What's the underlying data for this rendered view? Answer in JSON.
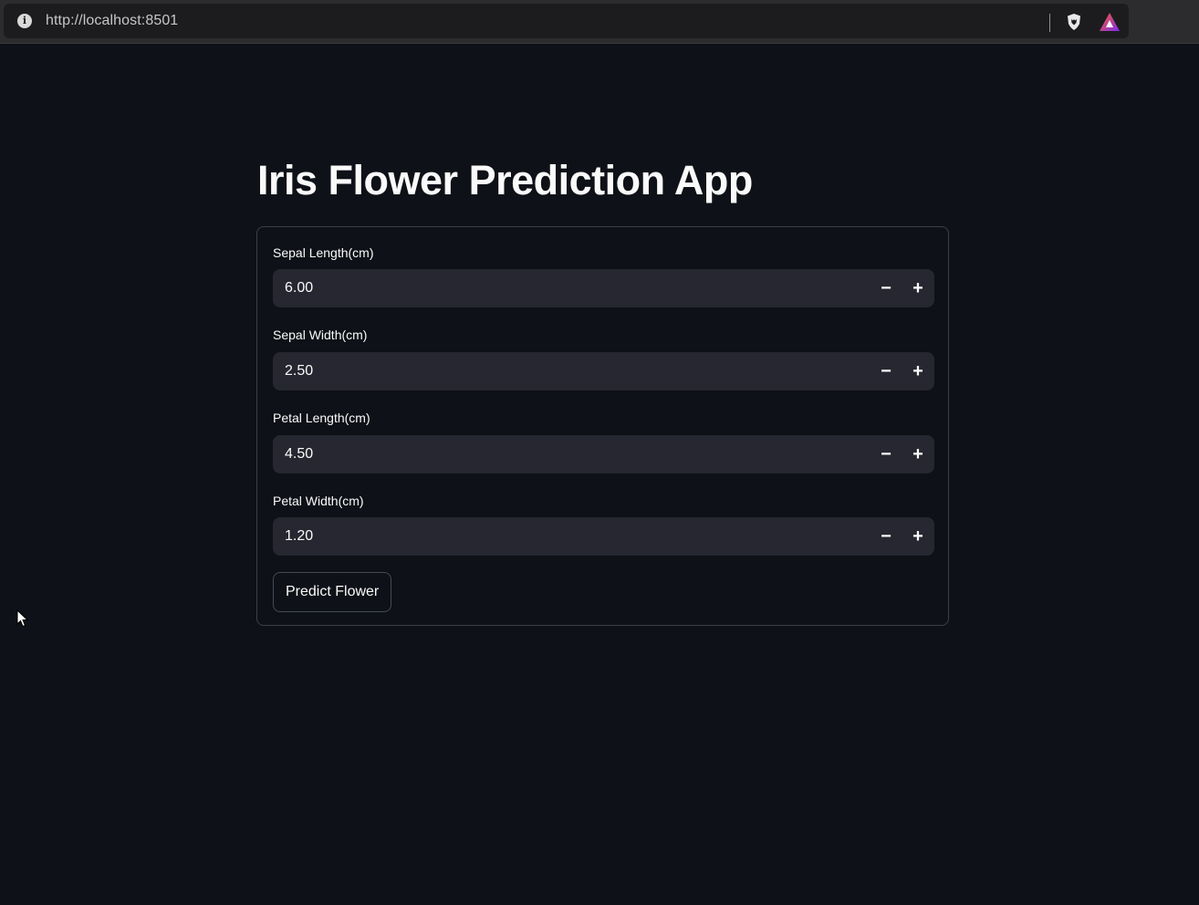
{
  "browser": {
    "url": "http://localhost:8501",
    "icons": [
      "info-icon",
      "brave-shield-icon",
      "brave-rewards-icon"
    ]
  },
  "app": {
    "title": "Iris Flower Prediction App"
  },
  "form": {
    "fields": [
      {
        "label": "Sepal Length(cm)",
        "value": "6.00"
      },
      {
        "label": "Sepal Width(cm)",
        "value": "2.50"
      },
      {
        "label": "Petal Length(cm)",
        "value": "4.50"
      },
      {
        "label": "Petal Width(cm)",
        "value": "1.20"
      }
    ],
    "stepper": {
      "minus": "−",
      "plus": "+"
    },
    "submit_label": "Predict Flower"
  },
  "colors": {
    "background": "#0e1117",
    "input_background": "#262730",
    "text": "#fafafa",
    "card_border": "#3d4049"
  }
}
